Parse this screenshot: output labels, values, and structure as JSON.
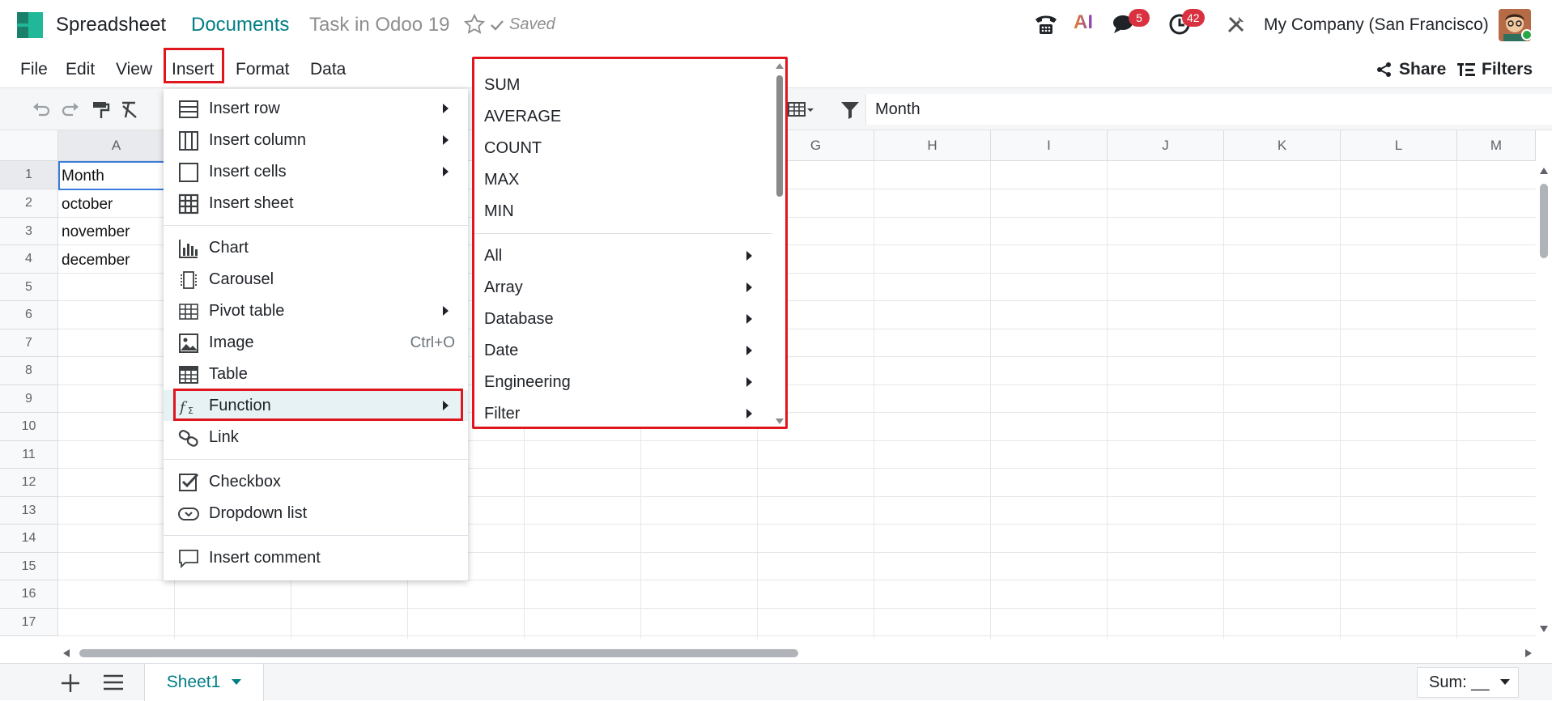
{
  "topbar": {
    "app_name": "Spreadsheet",
    "breadcrumb_documents": "Documents",
    "document_title": "Task in Odoo 19",
    "saved_label": "Saved",
    "ai_label": "AI",
    "messages_badge": "5",
    "activities_badge": "42",
    "company": "My Company (San Francisco)"
  },
  "menubar": {
    "items": [
      "File",
      "Edit",
      "View",
      "Insert",
      "Format",
      "Data"
    ],
    "share_label": "Share",
    "filters_label": "Filters"
  },
  "toolbar": {
    "composer_value": "Month"
  },
  "grid": {
    "columns": [
      "A",
      "G",
      "H",
      "I",
      "J",
      "K",
      "L",
      "M"
    ],
    "rows": [
      "1",
      "2",
      "3",
      "4",
      "5",
      "6",
      "7",
      "8",
      "9",
      "10",
      "11",
      "12",
      "13",
      "14",
      "15",
      "16",
      "17"
    ],
    "cells": [
      "Month",
      "october",
      "november",
      "december"
    ]
  },
  "insert_menu": {
    "items": [
      {
        "label": "Insert row",
        "icon": "insert-row-icon"
      },
      {
        "label": "Insert column",
        "icon": "insert-column-icon"
      },
      {
        "label": "Insert cells",
        "icon": "insert-cells-icon"
      },
      {
        "label": "Insert sheet",
        "icon": "insert-sheet-icon"
      },
      {
        "label": "Chart",
        "icon": "chart-icon"
      },
      {
        "label": "Carousel",
        "icon": "carousel-icon"
      },
      {
        "label": "Pivot table",
        "icon": "pivot-table-icon"
      },
      {
        "label": "Image",
        "icon": "image-icon",
        "shortcut": "Ctrl+O"
      },
      {
        "label": "Table",
        "icon": "table-icon"
      },
      {
        "label": "Function",
        "icon": "function-icon"
      },
      {
        "label": "Link",
        "icon": "link-icon"
      },
      {
        "label": "Checkbox",
        "icon": "checkbox-icon"
      },
      {
        "label": "Dropdown list",
        "icon": "dropdown-list-icon"
      },
      {
        "label": "Insert comment",
        "icon": "comment-icon"
      }
    ]
  },
  "function_menu": {
    "common": [
      "SUM",
      "AVERAGE",
      "COUNT",
      "MAX",
      "MIN"
    ],
    "categories": [
      "All",
      "Array",
      "Database",
      "Date",
      "Engineering",
      "Filter"
    ]
  },
  "bottombar": {
    "sheet_tab": "Sheet1",
    "sum_label": "Sum: __"
  },
  "colors": {
    "accent": "#017e84",
    "badge": "#d9313f",
    "highlight": "#e0161e",
    "logo": "#21b799"
  }
}
